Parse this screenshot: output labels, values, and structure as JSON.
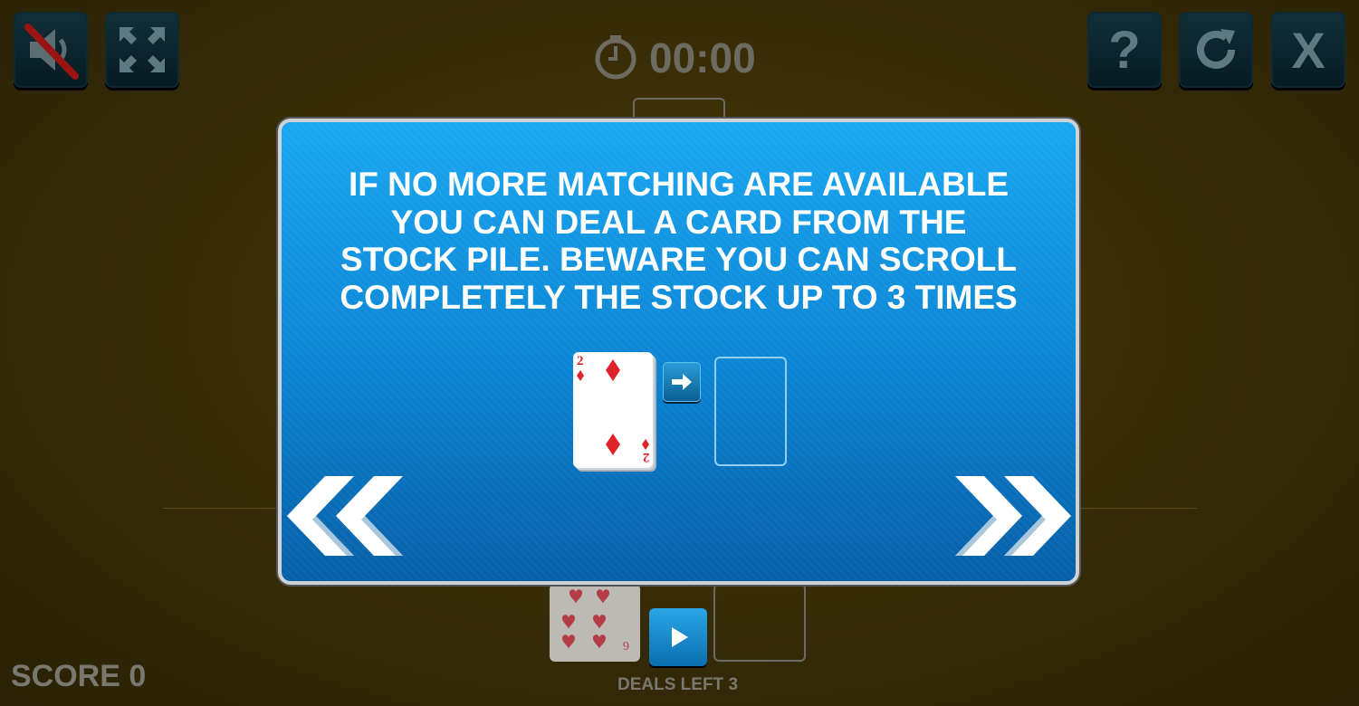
{
  "topbar": {
    "timer": "00:00",
    "buttons": {
      "mute": "speaker-muted-icon",
      "fullscreen": "expand-arrows-icon",
      "help": "?",
      "restart": "restart-icon",
      "close": "X"
    }
  },
  "game": {
    "score_label": "SCORE 0",
    "deals_left_label": "DEALS LEFT 3"
  },
  "dialog": {
    "lines": [
      "IF NO MORE MATCHING ARE AVAILABLE",
      "YOU CAN DEAL A CARD FROM THE",
      "STOCK PILE. BEWARE YOU CAN SCROLL",
      "COMPLETELY THE STOCK UP TO 3 TIMES"
    ],
    "demo_card": {
      "rank": "2",
      "suit": "diamonds"
    },
    "prev_icon": "double-chevron-left-icon",
    "next_icon": "double-chevron-right-icon"
  },
  "colors": {
    "dialog_blue": "#0b83d2",
    "felt": "#3a2e08",
    "suit_red": "#e0222a"
  }
}
